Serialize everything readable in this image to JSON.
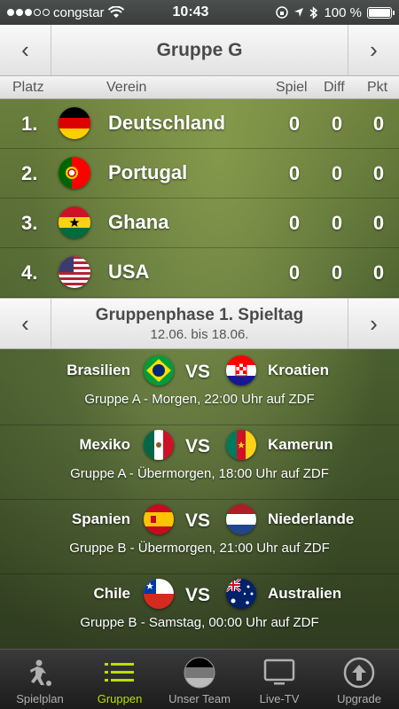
{
  "status": {
    "carrier": "congstar",
    "time": "10:43",
    "battery": "100 %"
  },
  "header": {
    "title": "Gruppe G",
    "prev": "‹",
    "next": "›"
  },
  "table": {
    "columns": {
      "place": "Platz",
      "club": "Verein",
      "games": "Spiel",
      "diff": "Diff",
      "points": "Pkt"
    },
    "rows": [
      {
        "pos": "1.",
        "team": "Deutschland",
        "flag": "germany-flag-icon",
        "games": "0",
        "diff": "0",
        "points": "0"
      },
      {
        "pos": "2.",
        "team": "Portugal",
        "flag": "portugal-flag-icon",
        "games": "0",
        "diff": "0",
        "points": "0"
      },
      {
        "pos": "3.",
        "team": "Ghana",
        "flag": "ghana-flag-icon",
        "games": "0",
        "diff": "0",
        "points": "0"
      },
      {
        "pos": "4.",
        "team": "USA",
        "flag": "usa-flag-icon",
        "games": "0",
        "diff": "0",
        "points": "0"
      }
    ]
  },
  "round": {
    "title": "Gruppenphase 1. Spieltag",
    "dates": "12.06. bis 18.06."
  },
  "matches": [
    {
      "home": "Brasilien",
      "away": "Kroatien",
      "vs": "VS",
      "info": "Gruppe A - Morgen, 22:00 Uhr auf ZDF"
    },
    {
      "home": "Mexiko",
      "away": "Kamerun",
      "vs": "VS",
      "info": "Gruppe A - Übermorgen, 18:00 Uhr auf ZDF"
    },
    {
      "home": "Spanien",
      "away": "Niederlande",
      "vs": "VS",
      "info": "Gruppe B - Übermorgen, 21:00 Uhr auf ZDF"
    },
    {
      "home": "Chile",
      "away": "Australien",
      "vs": "VS",
      "info": "Gruppe B - Samstag, 00:00 Uhr auf ZDF"
    }
  ],
  "tabs": [
    {
      "label": "Spielplan",
      "icon": "soccer-player-icon"
    },
    {
      "label": "Gruppen",
      "icon": "list-icon",
      "active": true
    },
    {
      "label": "Unser Team",
      "icon": "team-flag-icon"
    },
    {
      "label": "Live-TV",
      "icon": "tv-icon"
    },
    {
      "label": "Upgrade",
      "icon": "upload-arrow-icon"
    }
  ],
  "colors": {
    "accent": "#b8e000",
    "tabbar": "#1c1c1c"
  }
}
